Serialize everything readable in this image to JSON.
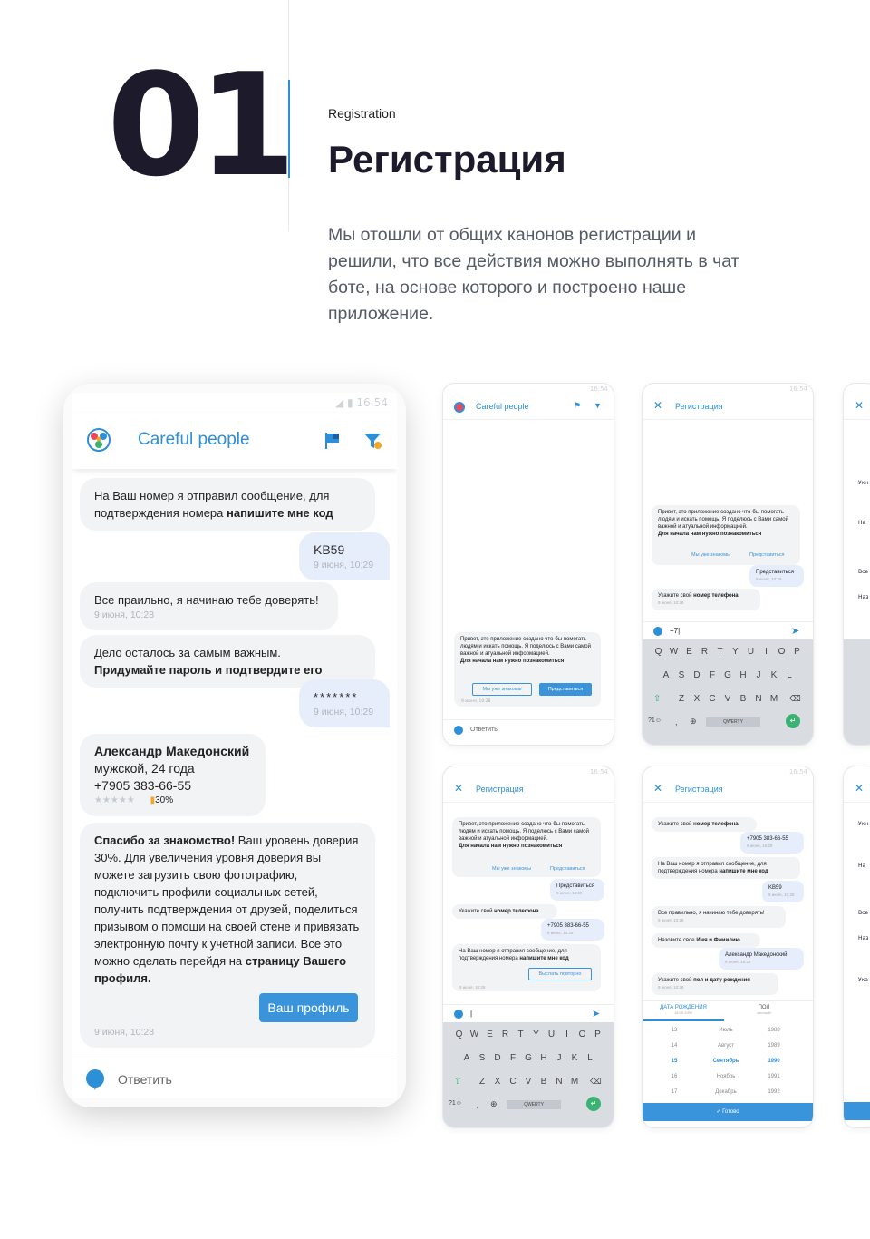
{
  "section": {
    "number": "01",
    "subtitle": "Registration",
    "title": "Регистрация",
    "description": "Мы отошли от общих канонов регистрации и решили, что все действия можно выполнять в чат боте, на основе которого и построено наше приложение."
  },
  "main_phone": {
    "status_time": "16:54",
    "app_name": "Careful people",
    "messages": {
      "m1_prefix": "На  Ваш номер я отправил сообщение, для подтверждения номера ",
      "m1_bold": "напишите мне код",
      "m2_text": "KB59",
      "m2_time": "9 июня, 10:29",
      "m3_text": "Все праильно, я начинаю тебе доверять!",
      "m3_time": "9 июня, 10:28",
      "m4_text": "Дело осталось за самым важным.",
      "m4_bold": "Придумайте пароль и подтвердите его",
      "m5_text": "*******",
      "m5_time": "9 июня, 10:29",
      "profile_name": "Александр Македонский",
      "profile_details": "мужской, 24 года",
      "profile_phone": "+7905 383-66-55",
      "profile_stars": "★★★★★",
      "profile_trust": "30%",
      "m7_bold1": "Спасибо за знакомство!",
      "m7_text": " Ваш уровень доверия 30%. Для увеличения уровня доверия вы можете загрузить свою фотографию, подключить профили социальных сетей, получить подтверждения от друзей, поделиться призывом о помощи на своей стене и привязать электронную почту к учетной записи. Все это можно сделать перейдя на ",
      "m7_bold2": "страницу Вашего профиля.",
      "profile_button": "Ваш профиль",
      "m7_time": "9 июня, 10:28"
    },
    "reply_label": "Ответить"
  },
  "small_screens": {
    "status_time": "16:54",
    "app_name": "Careful people",
    "reg_title": "Регистрация",
    "intro": "Привет, это приложение создано что-бы помогать людям и искать помощь. Я поделюсь с Вами самой важной и атуальной информацией.",
    "intro_bold": "Для начала нам нужно познакомиться",
    "link_known": "Мы уже знакомы",
    "link_intro": "Представиться",
    "btn_known": "Мы уже знакомы",
    "btn_intro": "Представиться",
    "time_28": "9 июня, 10:28",
    "time_29": "9 июня, 10:29",
    "reply": "Ответить",
    "me_intro": "Представиться",
    "ask_phone_prefix": "Укажите свой ",
    "ask_phone_bold": "номер телефона",
    "phone_value": "+7905 383-66-55",
    "code_sent": "На  Ваш номер я отправил сообщение, для подтверждения номера ",
    "code_sent_bold": "напишите мне код",
    "resend": "Выслать повторно",
    "input_value": "+7|",
    "code_value": "KB59",
    "trust_msg": "Все правильно, я начинаю тебе доверять!",
    "ask_name_prefix": "Назовите свое ",
    "ask_name_bold": "Имя и Фамилию",
    "name_value": "Александр Македонский",
    "ask_sex_prefix": "Укажите свой ",
    "ask_sex_bold": "пол и дату рождения",
    "tab_birth": "ДАТА РОЖДЕНИЯ",
    "tab_birth_sub": "15.09.1990",
    "tab_sex": "ПОЛ",
    "tab_sex_sub": "женский",
    "done": "Готово",
    "keyboard": {
      "row1": [
        "Q",
        "W",
        "E",
        "R",
        "T",
        "Y",
        "U",
        "I",
        "O",
        "P"
      ],
      "row2": [
        "A",
        "S",
        "D",
        "F",
        "G",
        "H",
        "J",
        "K",
        "L"
      ],
      "row3": [
        "Z",
        "X",
        "C",
        "V",
        "B",
        "N",
        "M"
      ],
      "sym": "?1☺",
      "comma": ",",
      "space": "QWERTY"
    },
    "picker": {
      "days": [
        "13",
        "14",
        "15",
        "16",
        "17"
      ],
      "months": [
        "Июль",
        "Август",
        "Сентябрь",
        "Ноябрь",
        "Декабрь"
      ],
      "years": [
        "1988",
        "1989",
        "1990",
        "1991",
        "1992"
      ]
    },
    "partial_letters": {
      "p1": "Укн",
      "p2": "На",
      "p3": "Все",
      "p4": "Наз",
      "p5": "Ука"
    }
  },
  "colors": {
    "accent": "#2d8fd8",
    "dark": "#1d1b2b",
    "bubble": "#f2f3f5",
    "bubble_me": "#e7eefb"
  }
}
